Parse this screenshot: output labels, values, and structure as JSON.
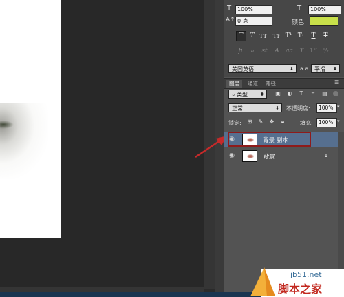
{
  "character_panel": {
    "font_size_value": "100%",
    "color_label": "颜色:",
    "tracking_value": "0 点",
    "scale_value": "100%",
    "language_value": "美国英语",
    "aa_icon_label": "a a",
    "antialias_value": "平滑",
    "text_color": "#c8e04a"
  },
  "layers_panel": {
    "tabs": [
      "图层",
      "通道",
      "路径"
    ],
    "filter_kind": "类型",
    "blend_mode": "正常",
    "opacity_label": "不透明度:",
    "opacity_value": "100%",
    "lock_label": "锁定:",
    "fill_label": "填充:",
    "fill_value": "100%",
    "layers": [
      {
        "name": "背景 副本",
        "selected": true
      },
      {
        "name": "背景",
        "selected": false
      }
    ]
  },
  "watermark": {
    "site": "jb51.net",
    "brand": "脚本之家"
  }
}
